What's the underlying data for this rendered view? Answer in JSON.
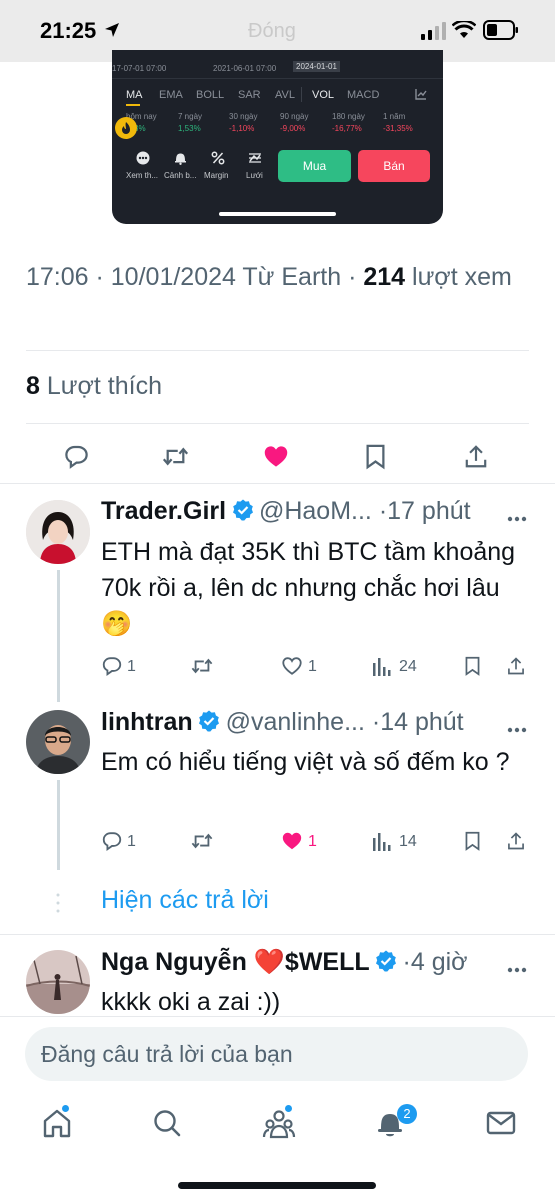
{
  "status_bar": {
    "time": "21:25",
    "faded_title": "Đóng"
  },
  "trading_card": {
    "chart_dates": [
      "17-07-01 07:00",
      "2021-06-01 07:00",
      "2024-01-01"
    ],
    "indicator_tabs": [
      "MA",
      "EMA",
      "BOLL",
      "SAR",
      "AVL",
      "VOL",
      "MACD"
    ],
    "periods": [
      {
        "label": "hôm nay",
        "value": "3%"
      },
      {
        "label": "7 ngày",
        "value": "1,53%"
      },
      {
        "label": "30 ngày",
        "value": "-1,10%"
      },
      {
        "label": "90 ngày",
        "value": "-9,00%"
      },
      {
        "label": "180 ngày",
        "value": "-16,77%"
      },
      {
        "label": "1 năm",
        "value": "-31,35%"
      }
    ],
    "actions": [
      "Xem th...",
      "Cảnh b...",
      "Margin",
      "Lưới"
    ],
    "buy_label": "Mua",
    "sell_label": "Bán"
  },
  "post_meta": {
    "time": "17:06",
    "date": "10/01/2024",
    "source": "Từ Earth",
    "views_count": "214",
    "views_label": "lượt xem"
  },
  "likes": {
    "count": "8",
    "label": "Lượt thích"
  },
  "replies": [
    {
      "name": "Trader.Girl",
      "handle": "@HaoM...",
      "time": "17 phút",
      "text": "ETH mà đạt 35K thì BTC tầm khoảng 70k rồi a, lên dc nhưng chắc hơi lâu 🤭",
      "reply_count": "1",
      "like_count": "1",
      "view_count": "24"
    },
    {
      "name": "linhtran",
      "handle": "@vanlinhe...",
      "time": "14 phút",
      "text": "Em có hiểu tiếng việt và số đếm ko ?",
      "reply_count": "1",
      "like_count": "1",
      "view_count": "14"
    },
    {
      "name": "Nga Nguyễn ❤️$WELL",
      "time": "4 giờ",
      "text": "kkkk oki a zai :))"
    }
  ],
  "show_replies_label": "Hiện các trả lời",
  "composer": {
    "placeholder": "Đăng câu trả lời của bạn"
  },
  "nav": {
    "notification_badge": "2"
  },
  "colors": {
    "accent": "#1d9bf0",
    "like": "#f91880",
    "buy": "#2ebd85",
    "sell": "#f6465d"
  }
}
